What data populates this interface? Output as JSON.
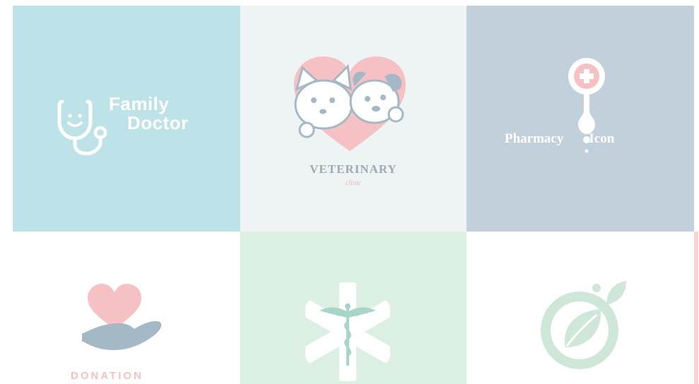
{
  "colors": {
    "tile_family_doctor": "#bde3e9",
    "tile_veterinary": "#eef4f4",
    "tile_pharmacy": "#c2d0db",
    "tile_donation": "#ffffff",
    "tile_medical": "#dcefe3",
    "tile_organic": "#ffffff",
    "accent_pink": "#f5c1c4",
    "accent_blue": "#a5b8c6",
    "veterinary_text": "#9eaab3",
    "veterinary_sub": "#f0b4b4",
    "donation_text": "#f4c2c2",
    "medical_mint": "#a7d5c7",
    "organic_green": "#cfe7d9",
    "edge_stripe": "#f7d3d3"
  },
  "logos": {
    "family_doctor": {
      "line1": "Family",
      "line2": "Doctor",
      "icon": "stethoscope-smile-icon"
    },
    "veterinary": {
      "title": "VETERINARY",
      "subtitle": "clinic",
      "icon": "cat-dog-heart-icon"
    },
    "pharmacy": {
      "word1": "Pharmacy",
      "word2": "Icon",
      "icon": "pharmacy-pin-cross-icon"
    },
    "donation": {
      "title": "DONATION",
      "icon": "hand-holding-heart-icon"
    },
    "medical": {
      "icon": "star-of-life-caduceus-icon"
    },
    "organic": {
      "icon": "leaf-circle-icon"
    }
  }
}
